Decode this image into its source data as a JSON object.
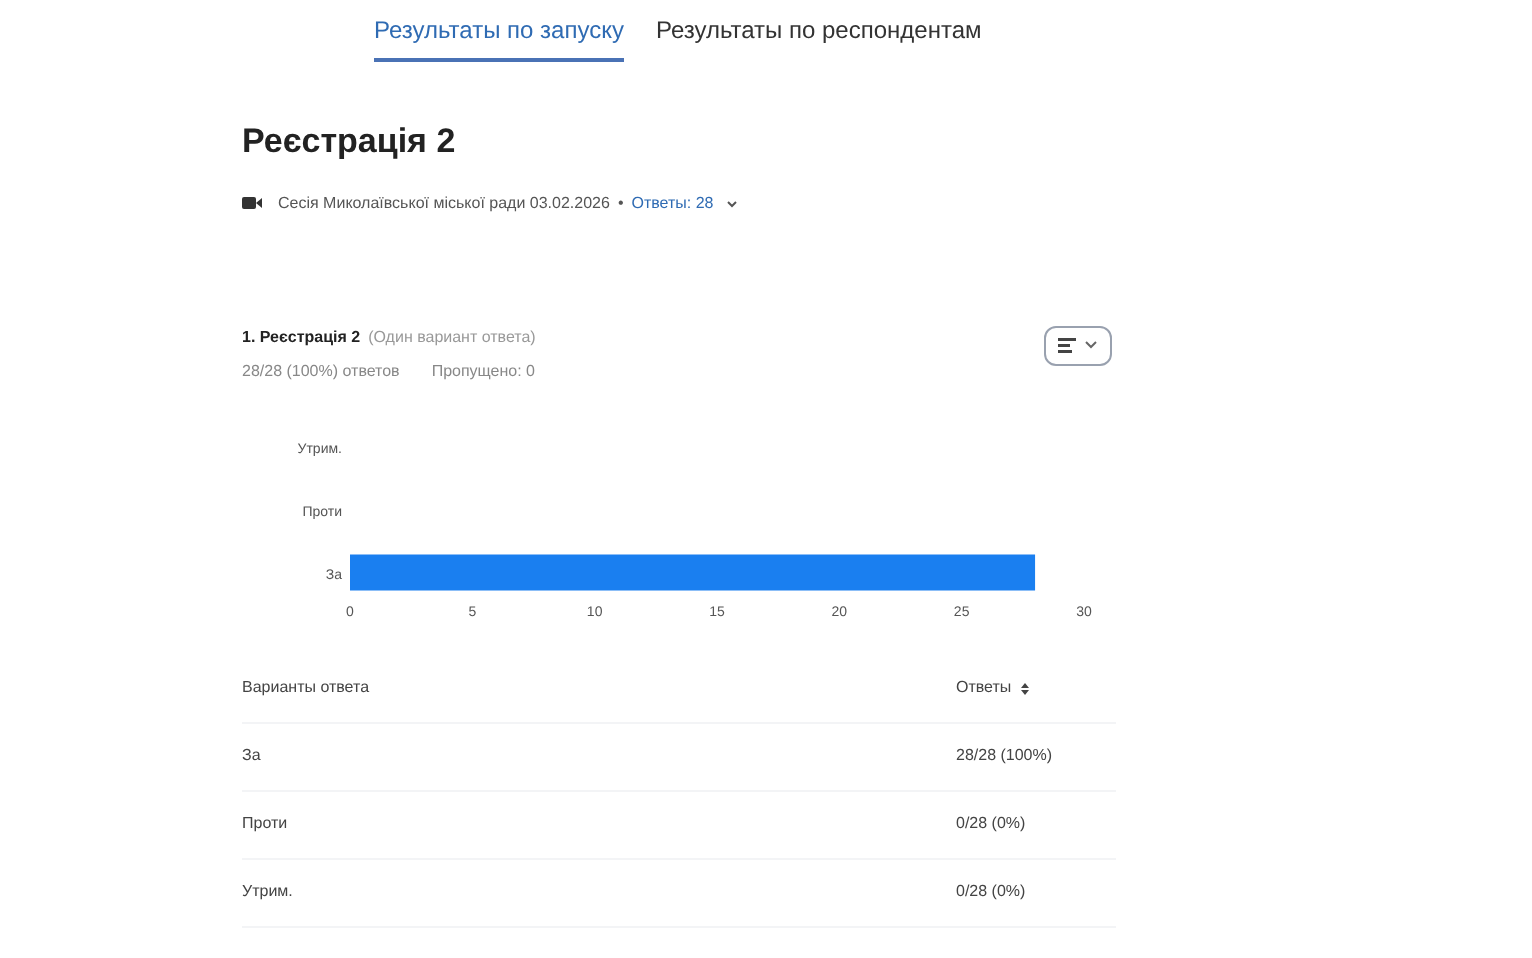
{
  "tabs": [
    {
      "label": "Результаты по запуску",
      "selected": true
    },
    {
      "label": "Результаты по респондентам",
      "selected": false
    }
  ],
  "title": "Реєстрація 2",
  "meta": {
    "session": "Сесія Миколаївської міської ради 03.02.2026",
    "separator": "•",
    "answers": "Ответы: 28"
  },
  "question": {
    "title": "1. Реєстрація 2",
    "type": "(Один вариант ответа)",
    "answered": "28/28 (100%) ответов",
    "skipped": "Пропущено: 0",
    "chart_data": {
      "type": "bar",
      "orientation": "horizontal",
      "categories": [
        "Утрим.",
        "Проти",
        "За"
      ],
      "series": [
        {
          "color": "#1a7ff0",
          "values": [
            0,
            0,
            28
          ]
        }
      ],
      "xlim": [
        0,
        30
      ],
      "xticks": [
        0,
        5,
        10,
        15,
        20,
        25,
        30
      ]
    }
  },
  "table": {
    "columns": [
      "Варианты ответа",
      "Ответы"
    ],
    "rows": [
      [
        "За",
        "28/28 (100%)"
      ],
      [
        "Проти",
        "0/28 (0%)"
      ],
      [
        "Утрим.",
        "0/28 (0%)"
      ]
    ]
  }
}
